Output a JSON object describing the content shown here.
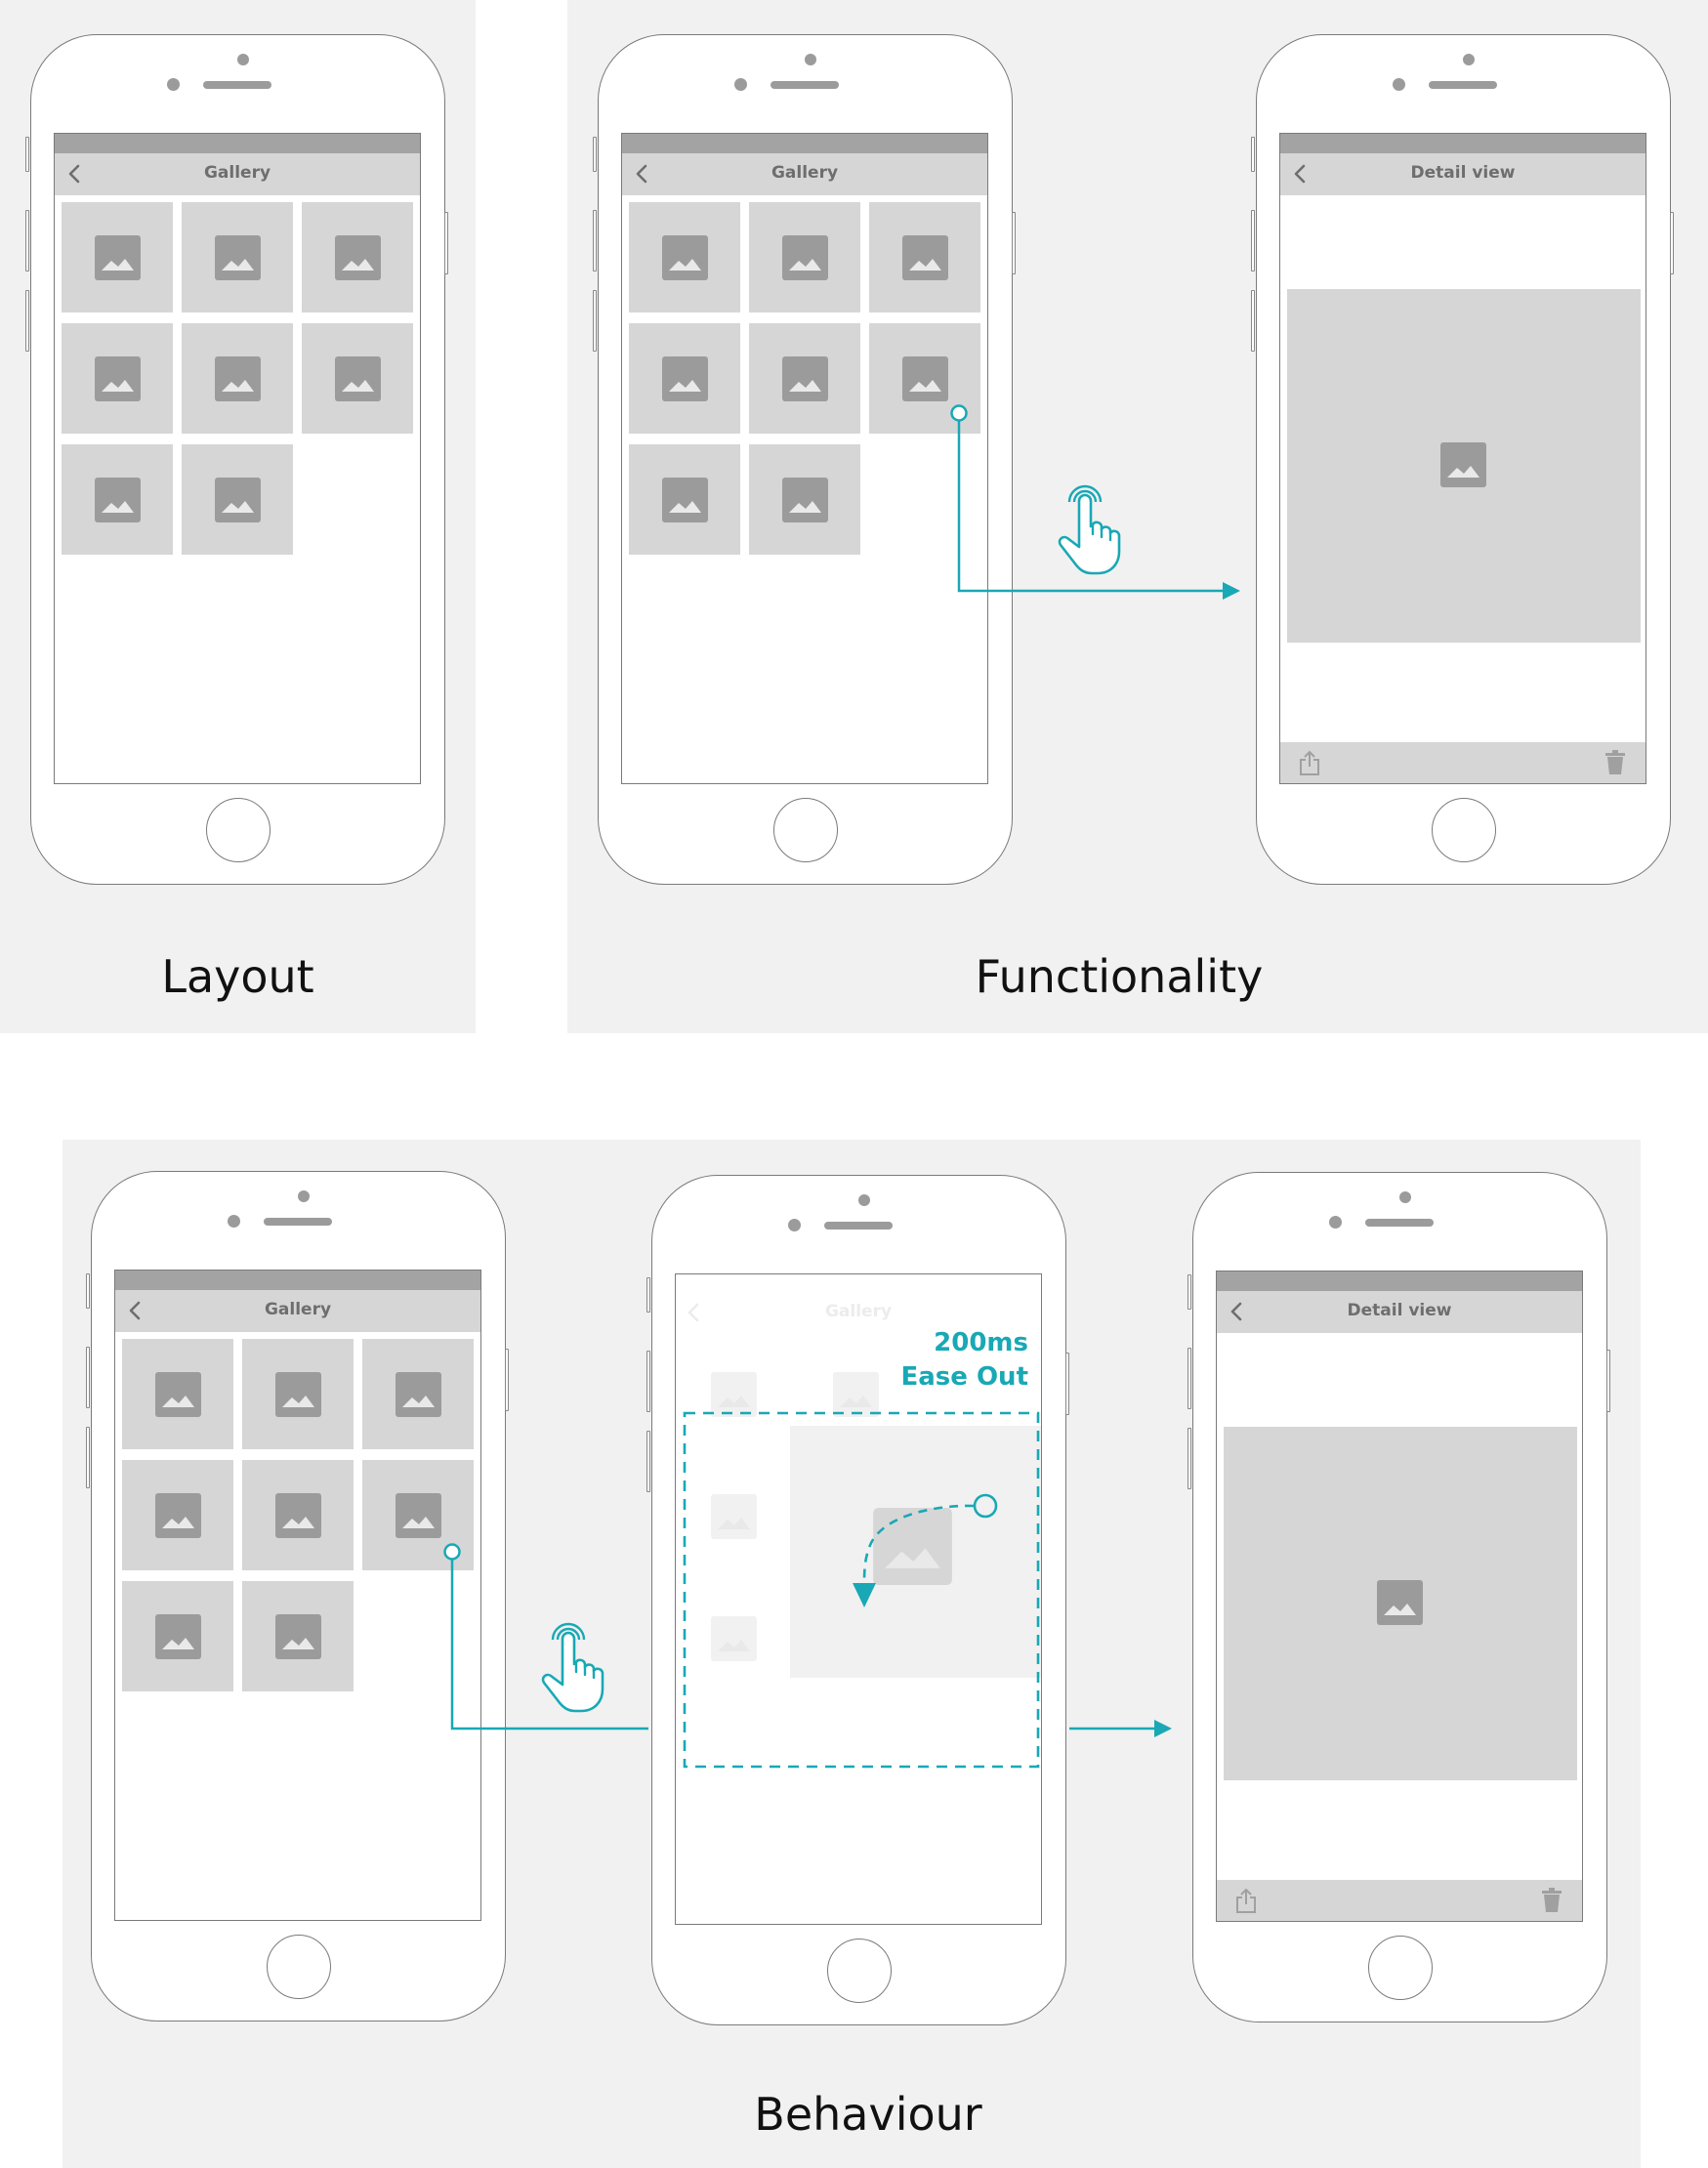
{
  "captions": {
    "layout": "Layout",
    "functionality": "Functionality",
    "behaviour": "Behaviour"
  },
  "screens": {
    "gallery_title": "Gallery",
    "detail_title": "Detail view",
    "faded_gallery_title": "Gallery"
  },
  "transition": {
    "duration": "200ms",
    "easing": "Ease Out"
  },
  "colors": {
    "accent": "#19a8b5",
    "panel_bg": "#f1f1f1",
    "tile": "#d7d6d7",
    "icon": "#9c9b9c",
    "status_bar": "#a3a3a3"
  },
  "icons": {
    "back": "chevron-left-icon",
    "image": "image-placeholder-icon",
    "tap": "tap-gesture-icon",
    "share": "share-icon",
    "delete": "trash-icon"
  }
}
